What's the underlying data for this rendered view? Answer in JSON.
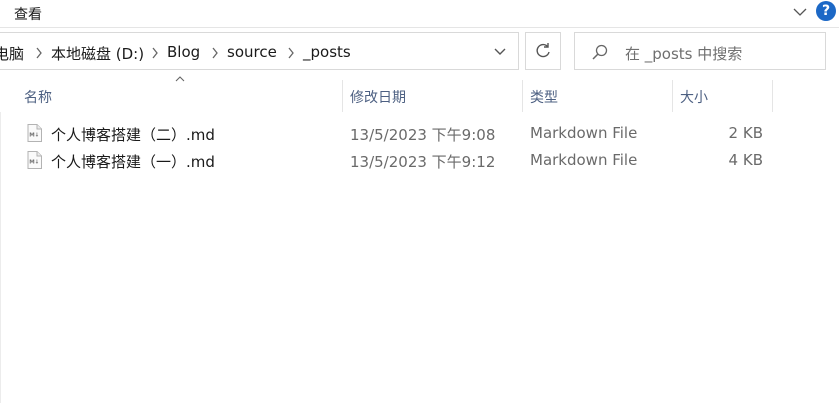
{
  "ribbon": {
    "view_tab": "查看",
    "help_label": "?"
  },
  "address": {
    "crumbs": [
      "电脑",
      "本地磁盘 (D:)",
      "Blog",
      "source",
      "_posts"
    ]
  },
  "search": {
    "placeholder": "在 _posts 中搜索"
  },
  "columns": {
    "name": "名称",
    "modified": "修改日期",
    "type": "类型",
    "size": "大小"
  },
  "files": [
    {
      "name": "个人博客搭建（二）.md",
      "modified": "13/5/2023 下午9:08",
      "type": "Markdown File",
      "size": "2 KB",
      "icon": "md-file-icon"
    },
    {
      "name": "个人博客搭建（一）.md",
      "modified": "13/5/2023 下午9:12",
      "type": "Markdown File",
      "size": "4 KB",
      "icon": "md-file-icon"
    }
  ],
  "colors": {
    "accent": "#1c68c6",
    "header_text": "#4d6082"
  }
}
